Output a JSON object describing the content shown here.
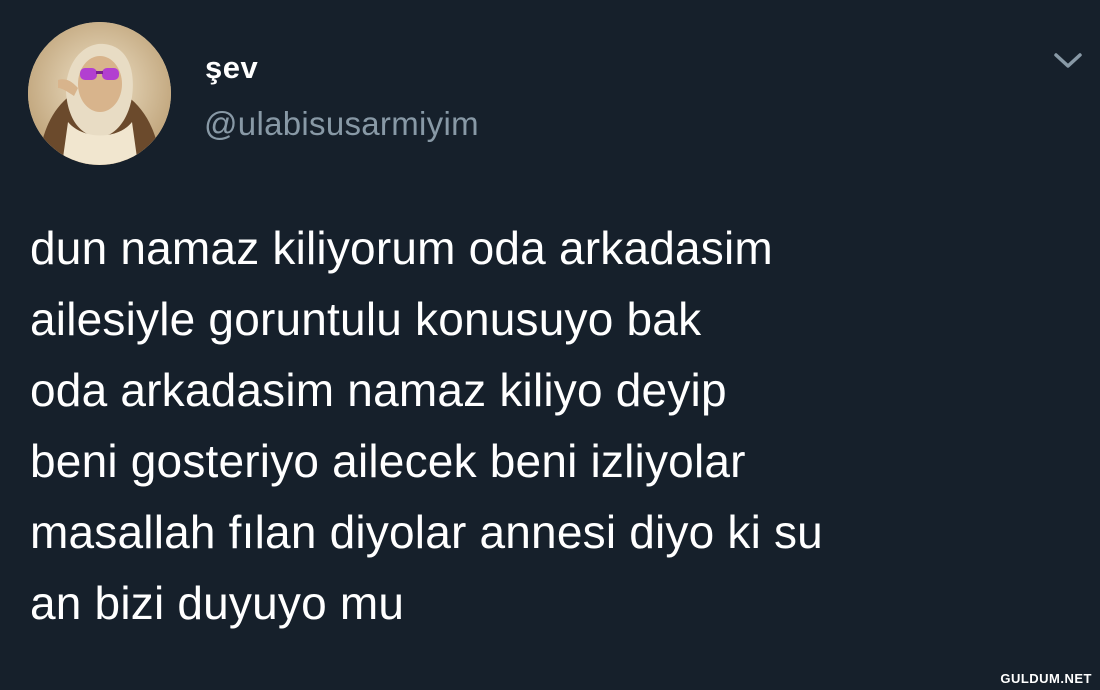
{
  "tweet": {
    "display_name": "şev",
    "handle": "@ulabisusarmiyim",
    "avatar_icon": "profile-photo",
    "menu_icon": "chevron-down-icon",
    "text_lines": [
      "dun namaz kiliyorum oda arkadasim",
      "ailesiyle goruntulu konusuyo bak",
      "oda arkadasim namaz kiliyo deyip",
      "beni gosteriyo ailecek beni izliyolar",
      "masallah fılan diyolar annesi diyo ki su",
      "an bizi duyuyo mu"
    ]
  },
  "watermark": "GULDUM.NET",
  "colors": {
    "background": "#16202b",
    "text": "#ffffff",
    "handle": "#8899a6"
  }
}
